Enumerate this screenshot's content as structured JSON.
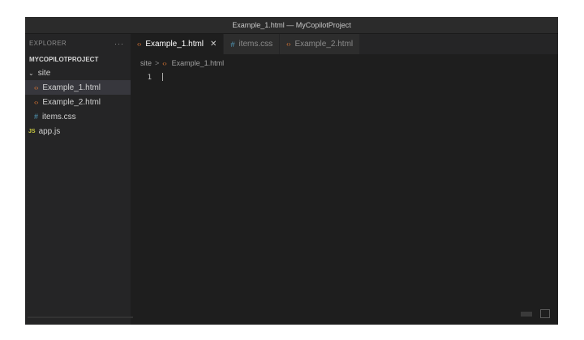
{
  "window": {
    "title": "Example_1.html — MyCopilotProject"
  },
  "sidebar": {
    "header": "EXPLORER",
    "more": "···",
    "project": "MYCOPILOTPROJECT",
    "folder": "site",
    "items": [
      {
        "label": "Example_1.html",
        "type": "html",
        "selected": true
      },
      {
        "label": "Example_2.html",
        "type": "html",
        "selected": false
      },
      {
        "label": "items.css",
        "type": "css",
        "selected": false
      }
    ],
    "root_file": {
      "label": "app.js",
      "type": "js"
    }
  },
  "tabs": [
    {
      "label": "Example_1.html",
      "active": true,
      "close": "✕"
    },
    {
      "label": "items.css",
      "active": false
    },
    {
      "label": "Example_2.html",
      "active": false
    }
  ],
  "breadcrumb": {
    "folder": "site",
    "separator": ">",
    "file": "Example_1.html"
  },
  "editor": {
    "line_number": "1"
  },
  "colors": {
    "editor_bg": "#1e1e1e",
    "sidebar_bg": "#252526",
    "html_icon": "#e37933",
    "css_icon": "#519aba",
    "js_icon": "#cbcb41"
  },
  "icons": {
    "html": "code-brackets-icon",
    "css": "hash-icon",
    "js": "js-icon",
    "folder": "chevron-down-icon"
  }
}
